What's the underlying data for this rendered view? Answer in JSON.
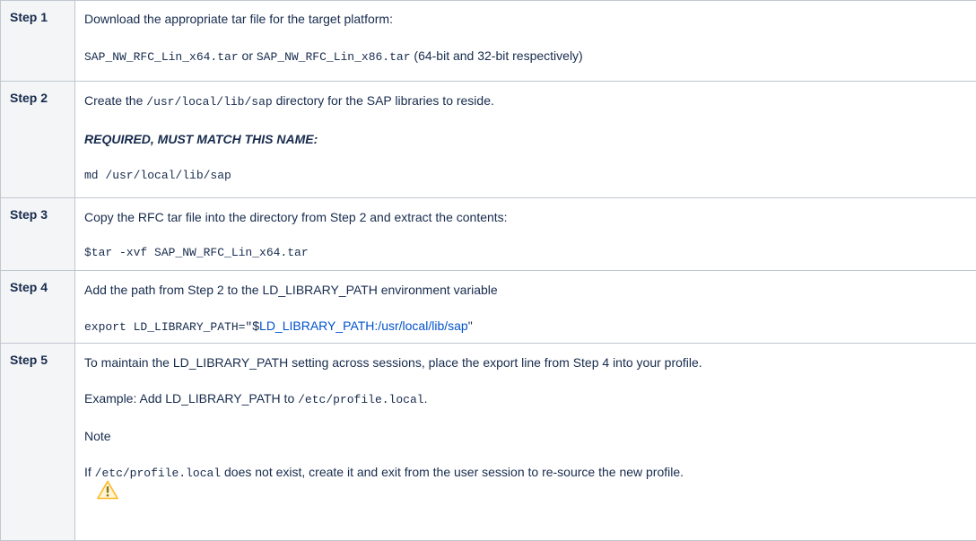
{
  "steps": [
    {
      "label": "Step 1",
      "intro": "Download the appropriate tar file for the target platform:",
      "file64": "SAP_NW_RFC_Lin_x64.tar",
      "or": " or ",
      "file86": "SAP_NW_RFC_Lin_x86.tar",
      "suffix": " (64-bit and 32-bit respectively)"
    },
    {
      "label": "Step 2",
      "pre": "Create the ",
      "dir": "/usr/local/lib/sap",
      "post": " directory for the SAP libraries to reside.",
      "required": "REQUIRED, MUST MATCH THIS NAME:",
      "cmd": "md /usr/local/lib/sap"
    },
    {
      "label": "Step 3",
      "intro": "Copy the RFC tar file into the directory from Step 2 and extract the contents:",
      "cmd": "$tar -xvf SAP_NW_RFC_Lin_x64.tar"
    },
    {
      "label": "Step 4",
      "intro": "Add the path from Step 2 to the LD_LIBRARY_PATH environment variable",
      "cmd_pre": "export LD_LIBRARY_PATH=\"",
      "cmd_dollar": "$",
      "cmd_link": "LD_LIBRARY_PATH:/usr/local/lib/sap",
      "cmd_quote": "\""
    },
    {
      "label": "Step 5",
      "intro": "To maintain the LD_LIBRARY_PATH setting across sessions, place the export line from Step 4 into your profile.",
      "example_pre": "Example: Add LD_LIBRARY_PATH to ",
      "example_path": "/etc/profile.local",
      "example_post": ".",
      "note_title": "Note",
      "note_pre": "If ",
      "note_path": "/etc/profile.local",
      "note_post": " does not exist, create it and exit from the user session to re-source the new profile."
    }
  ],
  "icons": {
    "note": "warning-icon"
  },
  "colors": {
    "link": "#0052cc",
    "label_bg": "#f4f5f7",
    "border": "#c1c7d0",
    "warning": "#ffab00"
  }
}
